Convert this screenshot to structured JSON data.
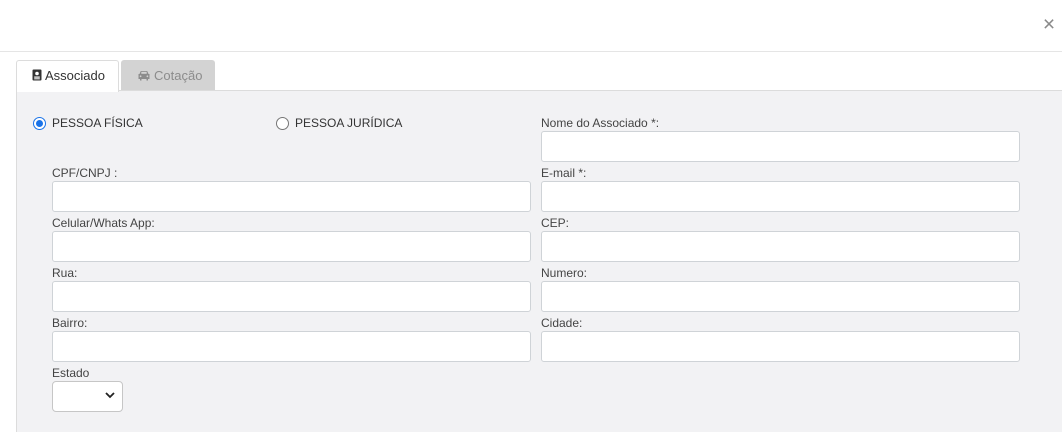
{
  "header": {
    "close_icon": "close-icon",
    "close_label": "×"
  },
  "tabs": [
    {
      "label": "Associado",
      "icon": "id-card-icon",
      "active": true
    },
    {
      "label": "Cotação",
      "icon": "car-icon",
      "active": false
    }
  ],
  "person_type": {
    "options": [
      {
        "label": "PESSOA FÍSICA",
        "checked": true
      },
      {
        "label": "PESSOA JURÍDICA",
        "checked": false
      }
    ]
  },
  "form": {
    "nome": {
      "label": "Nome do Associado *:",
      "value": ""
    },
    "cpf": {
      "label": "CPF/CNPJ :",
      "value": ""
    },
    "email": {
      "label": "E-mail *:",
      "value": ""
    },
    "celular": {
      "label": "Celular/Whats App:",
      "value": ""
    },
    "cep": {
      "label": "CEP:",
      "value": ""
    },
    "rua": {
      "label": "Rua:",
      "value": ""
    },
    "numero": {
      "label": "Numero:",
      "value": ""
    },
    "bairro": {
      "label": "Bairro:",
      "value": ""
    },
    "cidade": {
      "label": "Cidade:",
      "value": ""
    },
    "estado": {
      "label": "Estado",
      "selected": ""
    }
  },
  "colors": {
    "accent": "#1a73e8",
    "panel_bg": "#f2f2f4",
    "inactive_tab": "#d3d3d3"
  }
}
